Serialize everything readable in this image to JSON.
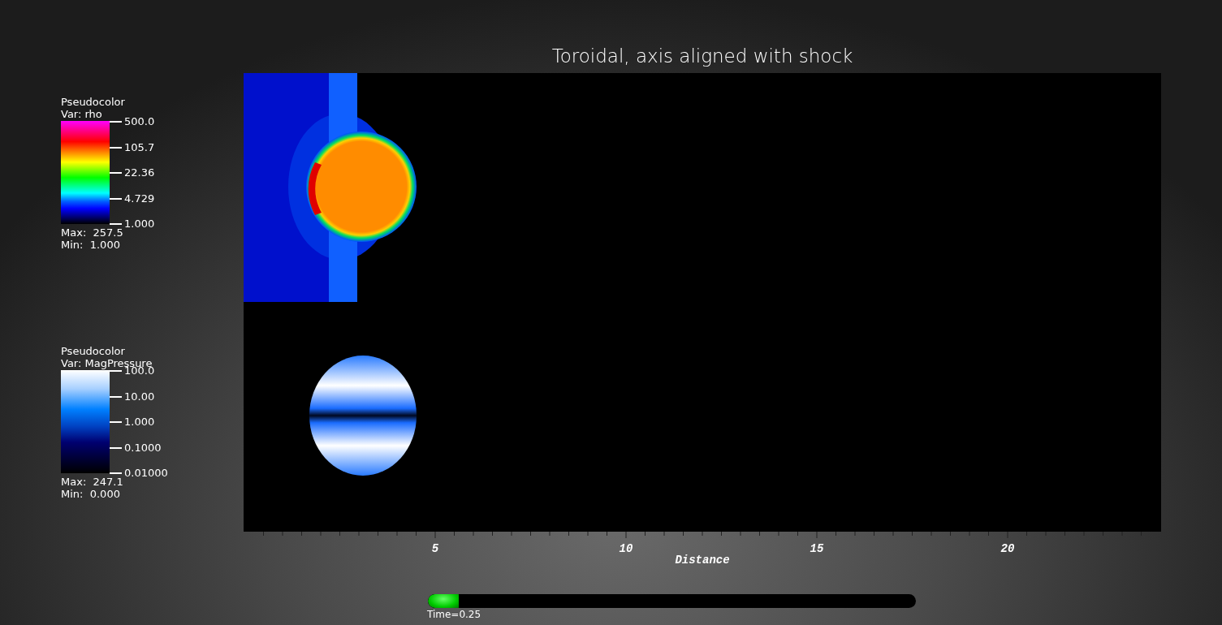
{
  "title": "Toroidal, axis aligned with shock",
  "legends": [
    {
      "kind": "rainbow",
      "plot": "Pseudocolor",
      "variable": "Var: rho",
      "ticks": [
        "500.0",
        "105.7",
        "22.36",
        "4.729",
        "1.000"
      ],
      "max": "Max:  257.5",
      "min": "Min:  1.000"
    },
    {
      "kind": "blues",
      "plot": "Pseudocolor",
      "variable": "Var: MagPressure",
      "ticks": [
        "100.0",
        "10.00",
        "1.000",
        "0.1000",
        "0.01000"
      ],
      "max": "Max:  247.1",
      "min": "Min:  0.000"
    }
  ],
  "x_axis": {
    "ticks": [
      "5",
      "10",
      "15",
      "20"
    ],
    "title": "Distance"
  },
  "time_slider": {
    "level": 0.063,
    "label": "Time=0.25"
  }
}
